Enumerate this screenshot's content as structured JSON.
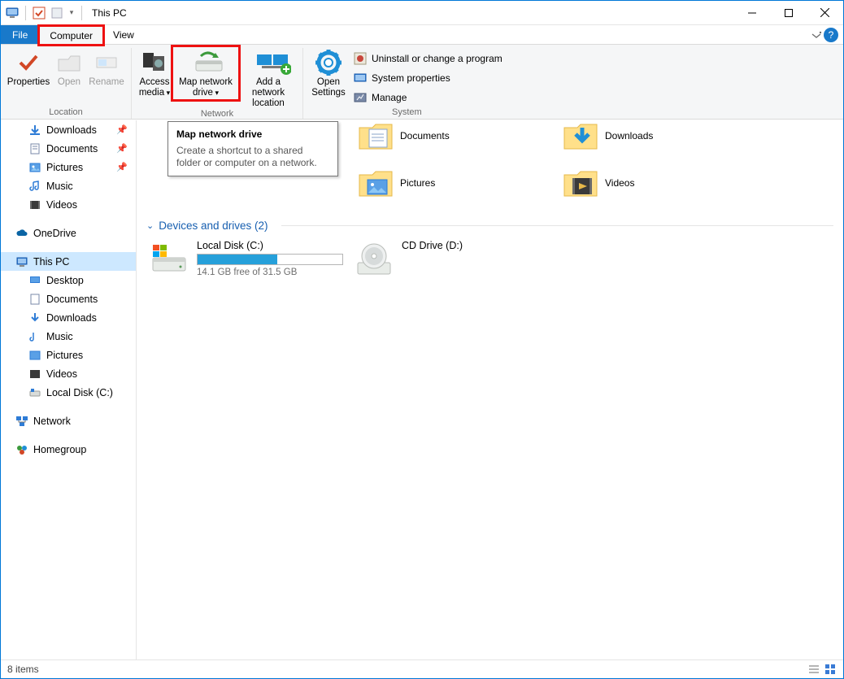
{
  "title": "This PC",
  "tabs": {
    "file": "File",
    "computer": "Computer",
    "view": "View"
  },
  "ribbon": {
    "location": {
      "label": "Location",
      "properties": "Properties",
      "open": "Open",
      "rename": "Rename"
    },
    "network": {
      "label": "Network",
      "access_media": "Access media",
      "map_drive": "Map network drive",
      "add_location": "Add a network location"
    },
    "system": {
      "label": "System",
      "open_settings": "Open Settings",
      "uninstall": "Uninstall or change a program",
      "sys_props": "System properties",
      "manage": "Manage"
    }
  },
  "tooltip": {
    "title": "Map network drive",
    "body": "Create a shortcut to a shared folder or computer on a network."
  },
  "nav": {
    "quick": [
      {
        "label": "Downloads",
        "pin": true
      },
      {
        "label": "Documents",
        "pin": true
      },
      {
        "label": "Pictures",
        "pin": true
      },
      {
        "label": "Music"
      },
      {
        "label": "Videos"
      }
    ],
    "onedrive": "OneDrive",
    "thispc": "This PC",
    "thispc_children": [
      "Desktop",
      "Documents",
      "Downloads",
      "Music",
      "Pictures",
      "Videos",
      "Local Disk (C:)"
    ],
    "network": "Network",
    "homegroup": "Homegroup"
  },
  "content": {
    "folders_row1": [
      {
        "label": "Documents"
      },
      {
        "label": "Downloads"
      }
    ],
    "folders_row2": [
      {
        "label": "Pictures"
      },
      {
        "label": "Videos"
      }
    ],
    "devices_header": "Devices and drives (2)",
    "drives": [
      {
        "label": "Local Disk (C:)",
        "free": "14.1 GB free of 31.5 GB",
        "fill_pct": 55
      },
      {
        "label": "CD Drive (D:)"
      }
    ]
  },
  "status": {
    "items": "8 items"
  }
}
